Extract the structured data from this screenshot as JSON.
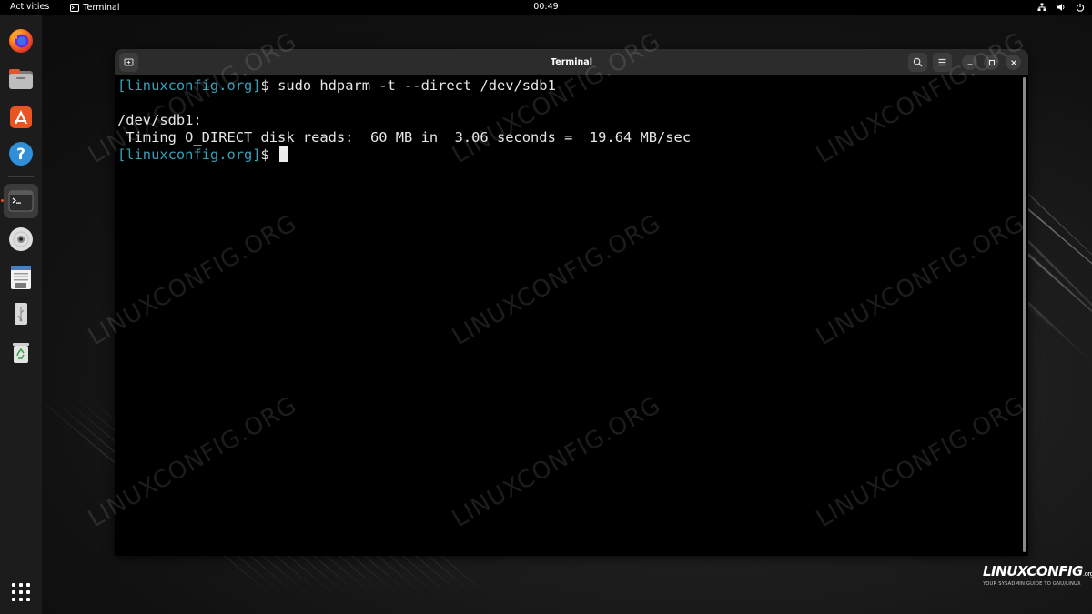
{
  "topbar": {
    "activities_label": "Activities",
    "app_name": "Terminal",
    "clock": "00:49"
  },
  "dock": {
    "items": [
      {
        "name": "firefox",
        "icon": "firefox-icon"
      },
      {
        "name": "files",
        "icon": "files-icon"
      },
      {
        "name": "app-center",
        "icon": "app-center-icon"
      },
      {
        "name": "help",
        "icon": "help-icon"
      },
      {
        "name": "terminal",
        "icon": "terminal-icon",
        "active": true
      },
      {
        "name": "optical-disc",
        "icon": "disc-icon"
      },
      {
        "name": "text-editor",
        "icon": "text-editor-icon"
      },
      {
        "name": "usb-drive",
        "icon": "usb-icon"
      },
      {
        "name": "trash",
        "icon": "trash-icon"
      }
    ],
    "show_apps_icon": "apps-grid-icon"
  },
  "terminal": {
    "title": "Terminal",
    "lines": [
      {
        "prompt": "[linuxconfig.org]",
        "text": "$ sudo hdparm -t --direct /dev/sdb1"
      },
      {
        "prompt": "",
        "text": ""
      },
      {
        "prompt": "",
        "text": "/dev/sdb1:"
      },
      {
        "prompt": "",
        "text": " Timing O_DIRECT disk reads:  60 MB in  3.06 seconds =  19.64 MB/sec"
      },
      {
        "prompt": "[linuxconfig.org]",
        "text": "$ "
      }
    ]
  },
  "watermark": {
    "text": "LINUXCONFIG.ORG"
  },
  "brand": {
    "name": "LINUXCONFIG",
    "suffix": ".org",
    "tagline": "YOUR SYSADMIN GUIDE TO GNU/LINUX"
  },
  "colors": {
    "prompt": "#34a0b8",
    "accent": "#e95420",
    "terminal_bg": "#000000",
    "header_bg": "#2c2c2c"
  }
}
